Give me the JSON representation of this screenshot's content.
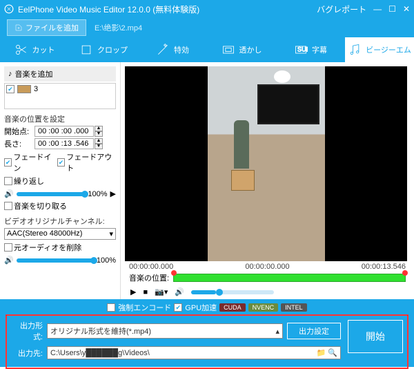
{
  "window": {
    "title": "EelPhone Video Music Editor 12.0.0 (無料体験版)",
    "report": "バグレポート"
  },
  "toolbar": {
    "add_file": "ファイルを追加",
    "filepath": "E:\\绝影\\2.mp4"
  },
  "tabs": {
    "cut": "カット",
    "crop": "クロップ",
    "effect": "特効",
    "watermark": "透かし",
    "subtitle": "字幕",
    "bgm": "ビージーエム"
  },
  "side": {
    "add_music": "音楽を追加",
    "track_name": "3",
    "pos_section": "音楽の位置を設定",
    "start_lbl": "開始点:",
    "start_val": "00 :00 :00 .000",
    "len_lbl": "長さ:",
    "len_val": "00 :00 :13 .546",
    "fadein": "フェードイン",
    "fadeout": "フェードアウト",
    "repeat": "繰り返し",
    "vol_pct": "100%",
    "trim": "音楽を切り取る",
    "orig_ch": "ビデオオリジナルチャンネル:",
    "codec": "AAC(Stereo 48000Hz)",
    "del_orig": "元オーディオを削除",
    "vol2_pct": "100%"
  },
  "preview": {
    "t0": "00:00:00.000",
    "t1": "00:00:00.000",
    "t2": "00:00:13.546",
    "music_pos_lbl": "音楽の位置:"
  },
  "bottom": {
    "force_enc": "強制エンコード",
    "gpu": "GPU加速",
    "cuda": "CUDA",
    "nvenc": "NVENC",
    "intel": "INTEL",
    "fmt_lbl": "出力形式:",
    "fmt_val": "オリジナル形式を維持(*.mp4)",
    "fmt_btn": "出力設定",
    "dst_lbl": "出力先:",
    "dst_val": "C:\\Users\\y██████g\\Videos\\",
    "start": "開始"
  }
}
